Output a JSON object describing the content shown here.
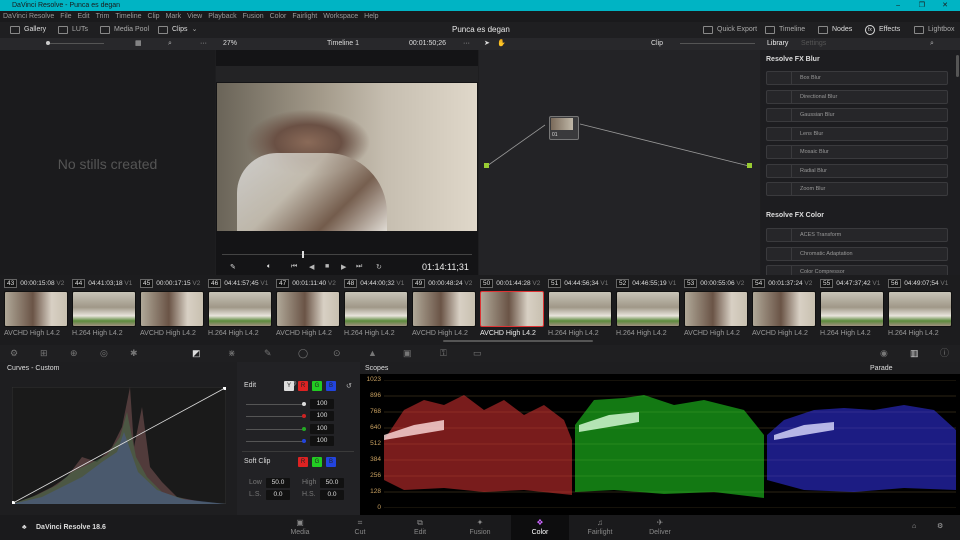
{
  "window": {
    "title": "DaVinci Resolve - Punca es degan",
    "controls": [
      "–",
      "❐",
      "✕"
    ]
  },
  "menu": [
    "DaVinci Resolve",
    "File",
    "Edit",
    "Trim",
    "Timeline",
    "Clip",
    "Mark",
    "View",
    "Playback",
    "Fusion",
    "Color",
    "Fairlight",
    "Workspace",
    "Help"
  ],
  "toolbar": {
    "gallery": "Gallery",
    "luts": "LUTs",
    "media_pool": "Media Pool",
    "clips": "Clips",
    "project_title": "Punca es degan",
    "quick_export": "Quick Export",
    "timeline": "Timeline",
    "nodes": "Nodes",
    "effects": "Effects",
    "lightbox": "Lightbox"
  },
  "viewer": {
    "zoom": "27%",
    "timeline_name": "Timeline 1",
    "source_timecode": "00:01:50;26",
    "current_timecode": "01:14:11;31",
    "playhead_fraction": 0.32
  },
  "gallery": {
    "empty_text": "No stills created"
  },
  "nodes": {
    "mode": "Clip",
    "node_label": "01"
  },
  "library": {
    "tabs": [
      "Library",
      "Settings"
    ],
    "sections": [
      {
        "title": "Resolve FX Blur",
        "items": [
          "Box Blur",
          "Directional Blur",
          "Gaussian Blur",
          "Lens Blur",
          "Mosaic Blur",
          "Radial Blur",
          "Zoom Blur"
        ]
      },
      {
        "title": "Resolve FX Color",
        "items": [
          "ACES Transform",
          "Chromatic Adaptation",
          "Color Compressor"
        ]
      }
    ]
  },
  "clips": [
    {
      "num": "43",
      "tc": "00:00:15:08",
      "track": "V2",
      "codec": "AVCHD High L4.2"
    },
    {
      "num": "44",
      "tc": "04:41:03;18",
      "track": "V1",
      "codec": "H.264 High L4.2"
    },
    {
      "num": "45",
      "tc": "00:00:17:15",
      "track": "V2",
      "codec": "AVCHD High L4.2"
    },
    {
      "num": "46",
      "tc": "04:41:57;45",
      "track": "V1",
      "codec": "H.264 High L4.2"
    },
    {
      "num": "47",
      "tc": "00:01:11:40",
      "track": "V2",
      "codec": "AVCHD High L4.2"
    },
    {
      "num": "48",
      "tc": "04:44:00;32",
      "track": "V1",
      "codec": "H.264 High L4.2"
    },
    {
      "num": "49",
      "tc": "00:00:48:24",
      "track": "V2",
      "codec": "AVCHD High L4.2"
    },
    {
      "num": "50",
      "tc": "00:01:44:28",
      "track": "V2",
      "codec": "AVCHD High L4.2"
    },
    {
      "num": "51",
      "tc": "04:44:56;34",
      "track": "V1",
      "codec": "H.264 High L4.2"
    },
    {
      "num": "52",
      "tc": "04:46:55;19",
      "track": "V1",
      "codec": "H.264 High L4.2"
    },
    {
      "num": "53",
      "tc": "00:00:55:06",
      "track": "V2",
      "codec": "AVCHD High L4.2"
    },
    {
      "num": "54",
      "tc": "00:01:37:24",
      "track": "V2",
      "codec": "AVCHD High L4.2"
    },
    {
      "num": "55",
      "tc": "04:47:37;42",
      "track": "V1",
      "codec": "H.264 High L4.2"
    },
    {
      "num": "56",
      "tc": "04:49:07;54",
      "track": "V1",
      "codec": "H.264 High L4.2"
    }
  ],
  "curves": {
    "title": "Curves - Custom",
    "edit_label": "Edit",
    "channels": [
      "Y",
      "R",
      "G",
      "B"
    ],
    "intensities": [
      "100",
      "100",
      "100",
      "100"
    ],
    "soft_clip": "Soft Clip",
    "low_label": "Low",
    "low": "50.0",
    "high_label": "High",
    "high": "50.0",
    "ls_label": "L.S.",
    "ls": "0.0",
    "hs_label": "H.S.",
    "hs": "0.0"
  },
  "scopes": {
    "title": "Scopes",
    "mode": "Parade",
    "scale": [
      "1023",
      "896",
      "768",
      "640",
      "512",
      "384",
      "256",
      "128",
      "0"
    ]
  },
  "bottom": {
    "app": "DaVinci Resolve 18.6",
    "pages": [
      "Media",
      "Cut",
      "Edit",
      "Fusion",
      "Color",
      "Fairlight",
      "Deliver"
    ],
    "active": "Color"
  }
}
